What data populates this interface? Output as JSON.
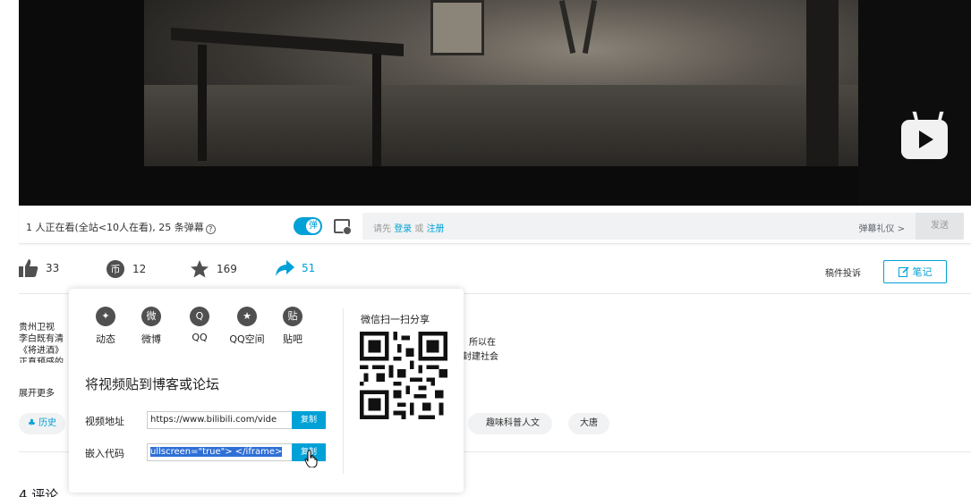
{
  "player": {
    "viewers_text": "1 人正在看(全站<10人在看), 25 条弹幕",
    "danmaku_toggle_glyph": "弹",
    "input_hint_prefix": "请先",
    "login_label": "登录",
    "or_label": "或",
    "register_label": "注册",
    "etiquette_label": "弹幕礼仪 >",
    "send_label": "发送"
  },
  "actions": {
    "like_count": "33",
    "coin_count": "12",
    "favorite_count": "169",
    "share_count": "51",
    "report_label": "稿件投诉",
    "notes_label": "笔记"
  },
  "description": {
    "lines": [
      "贵州卫视",
      "李白既有清",
      "《将进酒》",
      "正直预感的"
    ],
    "right_lines": [
      "所以在",
      "封建社会"
    ],
    "expand_label": "展开更多"
  },
  "tags": [
    "历史",
    "趣味科普人文",
    "大唐"
  ],
  "comments_label": "4 评论",
  "share_popover": {
    "platforms": [
      {
        "label": "动态",
        "glyph": "✦"
      },
      {
        "label": "微博",
        "glyph": "微"
      },
      {
        "label": "QQ",
        "glyph": "Q"
      },
      {
        "label": "QQ空间",
        "glyph": "★"
      },
      {
        "label": "贴吧",
        "glyph": "贴"
      }
    ],
    "title": "将视频贴到博客或论坛",
    "video_url_label": "视频地址",
    "video_url_value": "https://www.bilibili.com/vide",
    "embed_label": "嵌入代码",
    "embed_value": "ullscreen=\"true\"> </iframe>",
    "copy_label": "复制",
    "wechat_label": "微信扫一扫分享"
  },
  "colors": {
    "accent": "#00a1d6"
  }
}
